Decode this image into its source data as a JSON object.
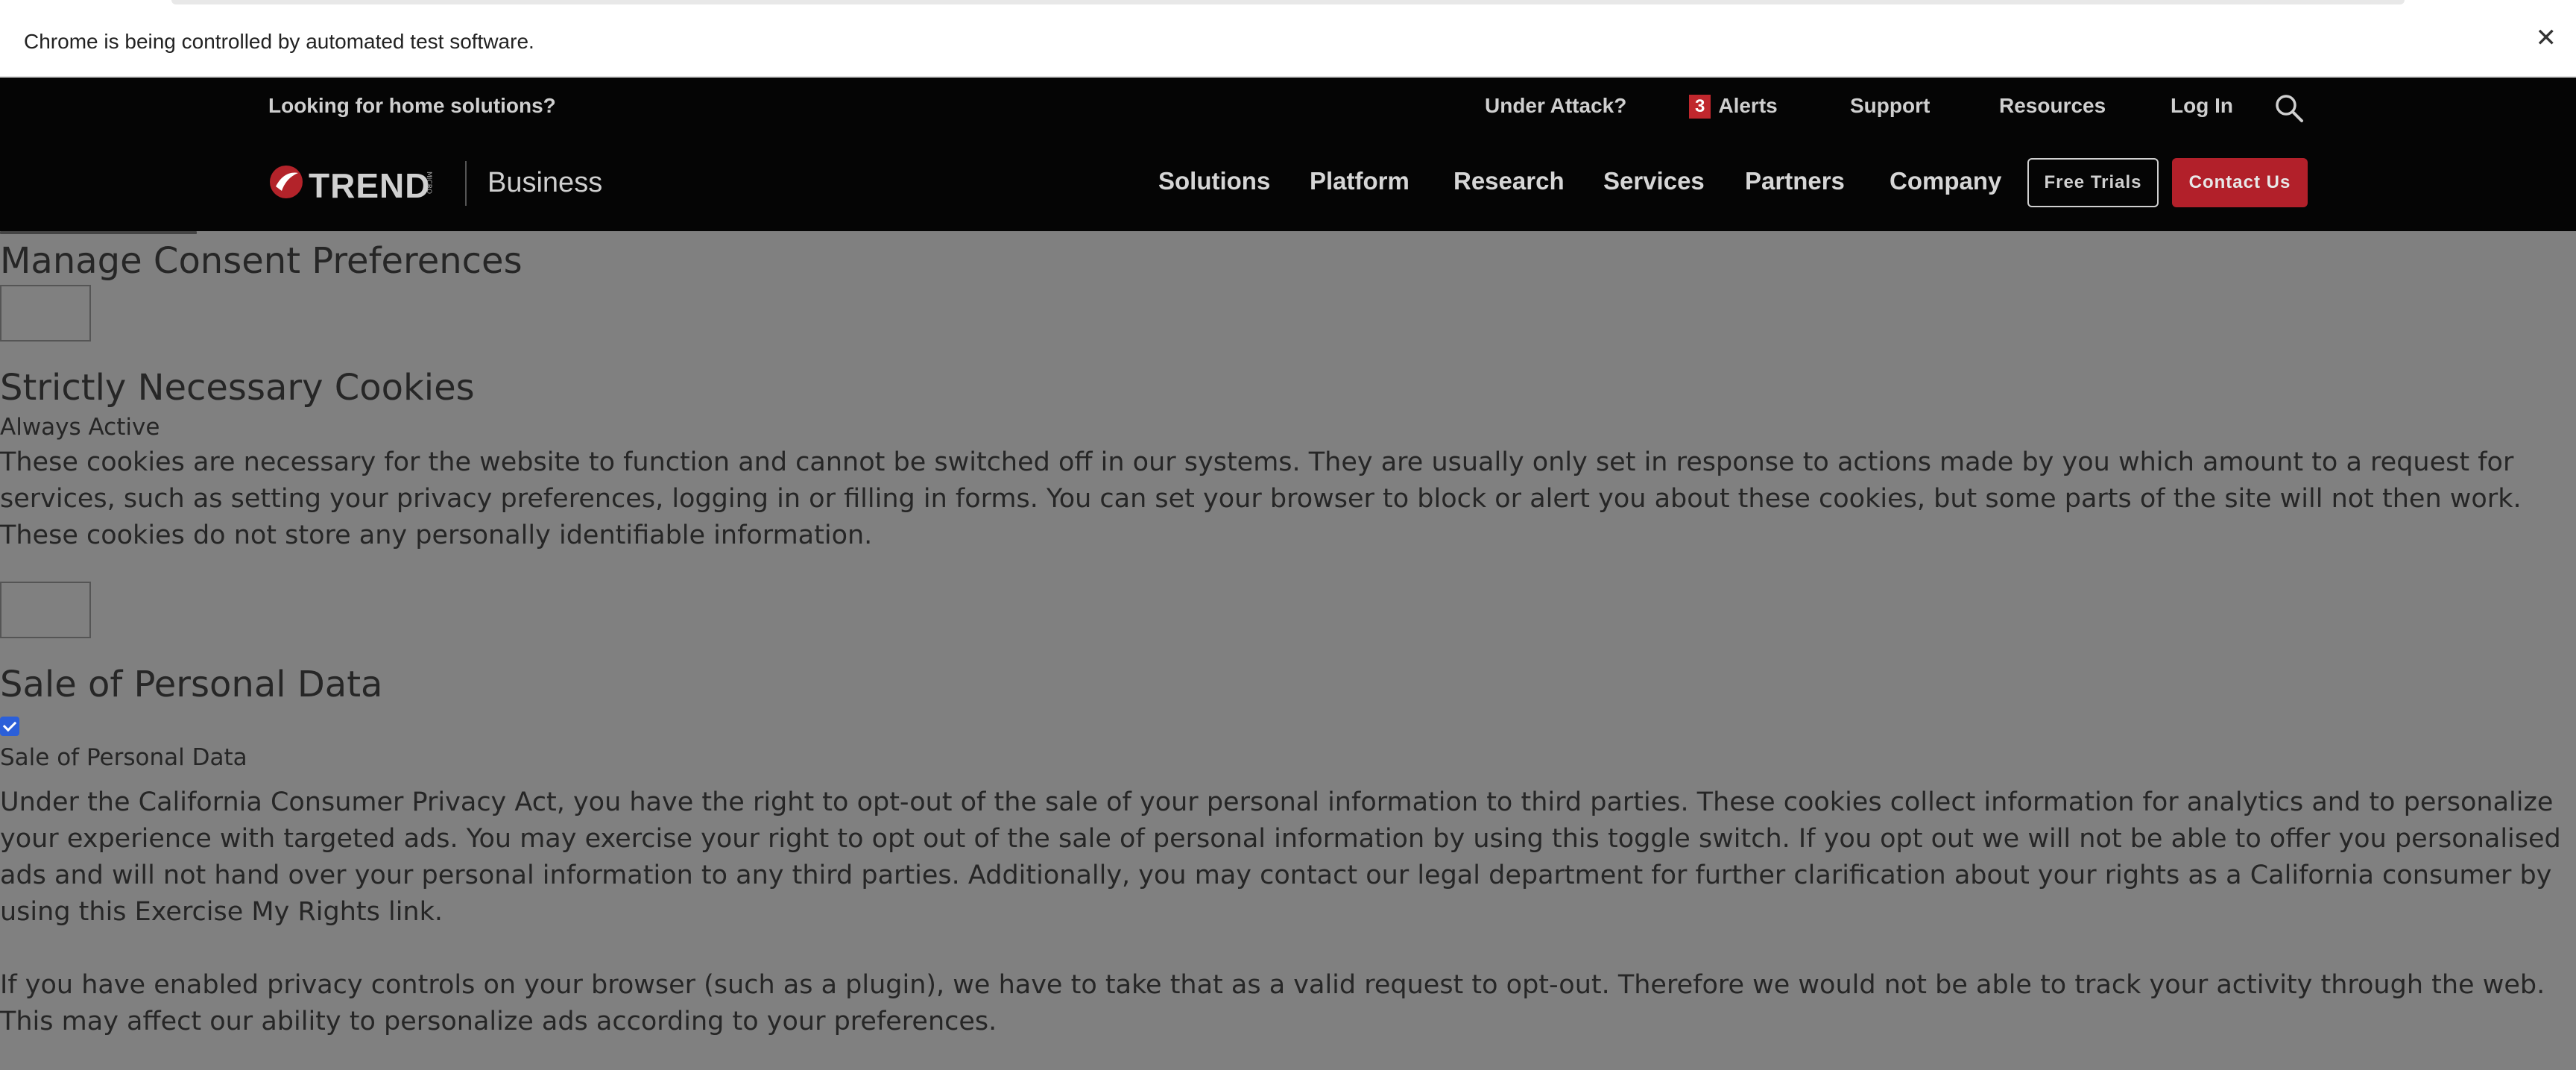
{
  "infobar": {
    "message": "Chrome is being controlled by automated test software.",
    "close_glyph": "✕"
  },
  "header": {
    "utility": {
      "promo_text": "Looking for home solutions?",
      "links": {
        "under_attack": "Under Attack?",
        "alerts_count": "3",
        "alerts": "Alerts",
        "support": "Support",
        "resources": "Resources",
        "login": "Log In"
      },
      "search_icon": "search-icon"
    },
    "brand": {
      "logo_text": "TREND",
      "logo_micro": "MICRO",
      "business": "Business"
    },
    "nav": {
      "solutions": "Solutions",
      "platform": "Platform",
      "research": "Research",
      "services": "Services",
      "partners": "Partners",
      "company": "Company"
    },
    "buttons": {
      "free_trials": "Free Trials",
      "contact_us": "Contact Us"
    },
    "colors": {
      "header_bg": "#050505",
      "accent_red": "#b2202a"
    }
  },
  "consent": {
    "title": "Manage Consent Preferences",
    "strictly": {
      "title": "Strictly Necessary Cookies",
      "status": "Always Active",
      "description": "These cookies are necessary for the website to function and cannot be switched off in our systems. They are usually only set in response to actions made by you which amount to a request for services, such as setting your privacy preferences, logging in or filling in forms. You can set your browser to block or alert you about these cookies, but some parts of the site will not then work. These cookies do not store any personally identifiable information."
    },
    "sale": {
      "title": "Sale of Personal Data",
      "checkbox_checked": true,
      "checkbox_label": "Sale of Personal Data",
      "description_1": "Under the California Consumer Privacy Act, you have the right to opt-out of the sale of your personal information to third parties. These cookies collect information for analytics and to personalize your experience with targeted ads. You may exercise your right to opt out of the sale of personal information by using this toggle switch. If you opt out we will not be able to offer you personalised ads and will not hand over your personal information to any third parties. Additionally, you may contact our legal department for further clarification about your rights as a California consumer by using this Exercise My Rights link.",
      "description_2": "If you have enabled privacy controls on your browser (such as a plugin), we have to take that as a valid request to opt-out. Therefore we would not be able to track your activity through the web. This may affect our ability to personalize ads according to your preferences."
    }
  }
}
